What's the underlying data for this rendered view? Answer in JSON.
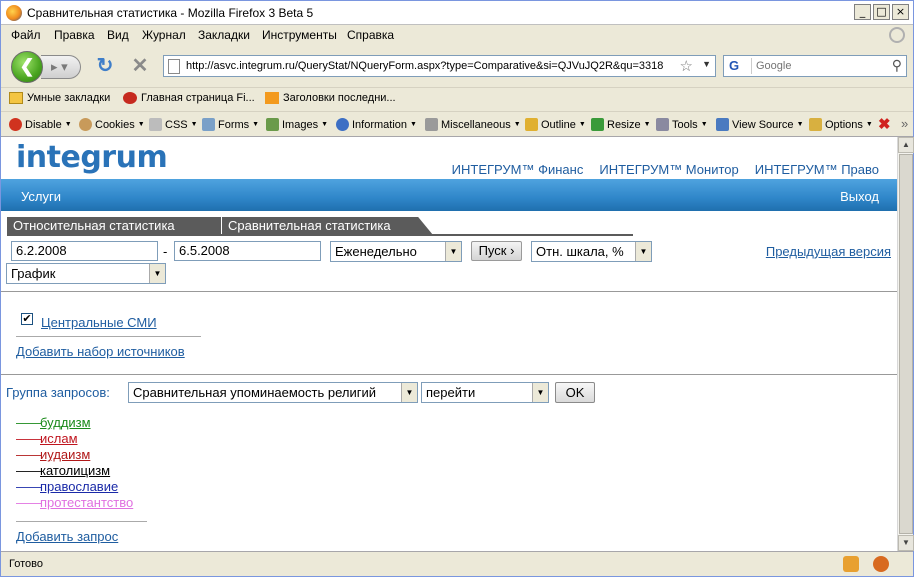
{
  "window": {
    "title": "Сравнительная статистика - Mozilla Firefox 3 Beta 5",
    "controls": [
      "_",
      "□",
      "×"
    ]
  },
  "menu": {
    "items": [
      "Файл",
      "Правка",
      "Вид",
      "Журнал",
      "Закладки",
      "Инструменты",
      "Справка"
    ]
  },
  "nav": {
    "url": "http://asvc.integrum.ru/QueryStat/NQueryForm.aspx?type=Comparative&si=QJVuJQ2R&qu=3318",
    "search_placeholder": "Google",
    "search_engine": "G"
  },
  "bookmarks": {
    "items": [
      "Умные закладки",
      "Главная страница Fi...",
      "Заголовки последни..."
    ]
  },
  "devbar": {
    "items": [
      "Disable",
      "Cookies",
      "CSS",
      "Forms",
      "Images",
      "Information",
      "Miscellaneous",
      "Outline",
      "Resize",
      "Tools",
      "View Source",
      "Options"
    ]
  },
  "page": {
    "logo": "integrum",
    "top_links": [
      "ИНТЕГРУМ™ Финанс",
      "ИНТЕГРУМ™ Монитор",
      "ИНТЕГРУМ™ Право"
    ],
    "services": "Услуги",
    "exit": "Выход",
    "tabs": [
      "Относительная статистика",
      "Сравнительная статистика"
    ],
    "date_from": "6.2.2008",
    "date_separator": "-",
    "date_to": "6.5.2008",
    "period": "Еженедельно",
    "go_button": "Пуск",
    "scale": "Отн. шкала, %",
    "prev_version": "Предыдущая версия",
    "view_type": "График",
    "source_checked": true,
    "source_label": "Центральные СМИ",
    "add_sources": "Добавить набор источников",
    "group_label": "Группа запросов:",
    "group_value": "Сравнительная упоминаемость религий",
    "goto_value": "перейти",
    "ok_button": "OK",
    "queries": [
      {
        "label": "буддизм",
        "color": "#1a8a1a"
      },
      {
        "label": "ислам",
        "color": "#c0141e"
      },
      {
        "label": "иудаизм",
        "color": "#b01818"
      },
      {
        "label": "католицизм",
        "color": "#000000"
      },
      {
        "label": "православие",
        "color": "#1a2aa8"
      },
      {
        "label": "протестантство",
        "color": "#e070e0"
      }
    ],
    "add_query": "Добавить запрос"
  },
  "status": {
    "text": "Готово"
  }
}
